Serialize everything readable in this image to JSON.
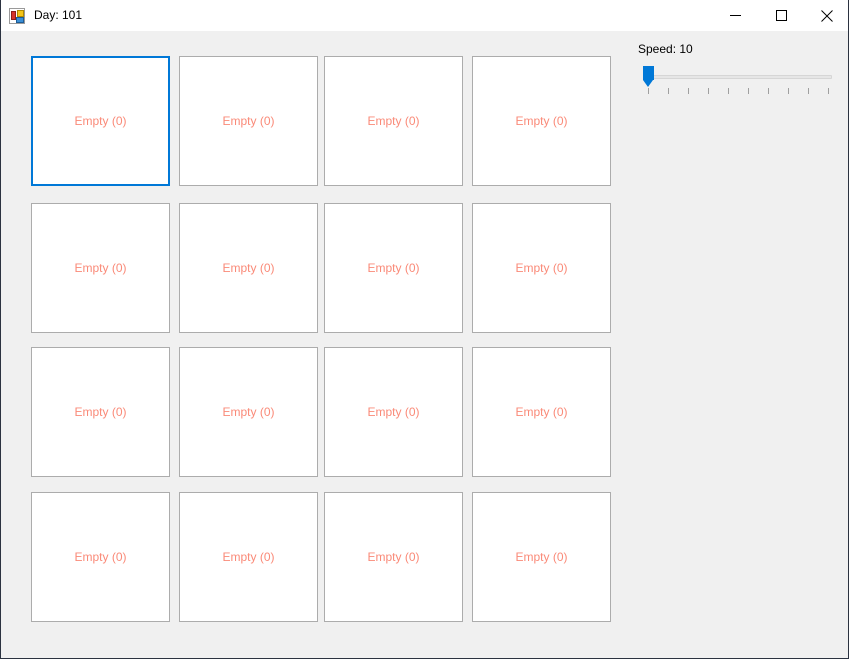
{
  "window": {
    "title": "Day: 101",
    "app_icon": "winforms-app-icon",
    "background_color": "#f0f0f0",
    "titlebar_color": "#ffffff",
    "border_color": "#2b3240",
    "caption_buttons": [
      {
        "name": "minimize",
        "glyph": "minimize-icon"
      },
      {
        "name": "maximize",
        "glyph": "maximize-icon"
      },
      {
        "name": "close",
        "glyph": "close-icon"
      }
    ]
  },
  "grid": {
    "columns": 4,
    "rows": 4,
    "cell_label_color": "#fa8a78",
    "cell_border_color": "#acacac",
    "selected_border_color": "#0078d7",
    "selected_index": 0,
    "cells": [
      {
        "label": "Empty (0)",
        "selected": true
      },
      {
        "label": "Empty (0)",
        "selected": false
      },
      {
        "label": "Empty (0)",
        "selected": false
      },
      {
        "label": "Empty (0)",
        "selected": false
      },
      {
        "label": "Empty (0)",
        "selected": false
      },
      {
        "label": "Empty (0)",
        "selected": false
      },
      {
        "label": "Empty (0)",
        "selected": false
      },
      {
        "label": "Empty (0)",
        "selected": false
      },
      {
        "label": "Empty (0)",
        "selected": false
      },
      {
        "label": "Empty (0)",
        "selected": false
      },
      {
        "label": "Empty (0)",
        "selected": false
      },
      {
        "label": "Empty (0)",
        "selected": false
      },
      {
        "label": "Empty (0)",
        "selected": false
      },
      {
        "label": "Empty (0)",
        "selected": false
      },
      {
        "label": "Empty (0)",
        "selected": false
      },
      {
        "label": "Empty (0)",
        "selected": false
      }
    ]
  },
  "speed_control": {
    "label": "Speed: 10",
    "value": 10,
    "thumb_color": "#0078d7",
    "track_color": "#e6e6e6",
    "tick_count": 10,
    "thumb_position_percent": 2
  }
}
